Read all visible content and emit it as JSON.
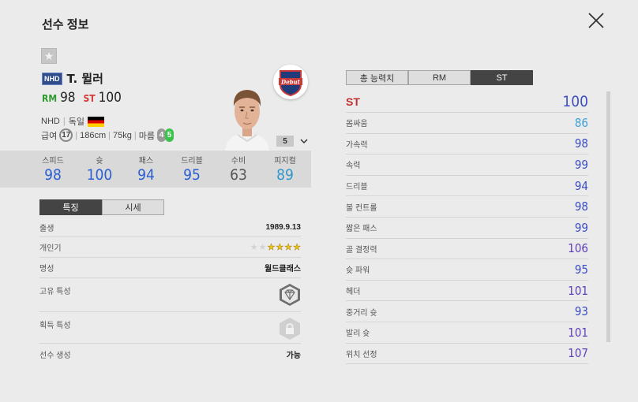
{
  "window": {
    "title": "선수 정보"
  },
  "player": {
    "season_tag": "NHD",
    "name": "T. 뮐러",
    "positions": [
      {
        "pos": "RM",
        "ovr": "98"
      },
      {
        "pos": "ST",
        "ovr": "100"
      }
    ],
    "club_season": "NHD",
    "nation": "독일",
    "salary_label": "급여",
    "salary": "17",
    "height": "186cm",
    "weight": "75kg",
    "body_type": "마름",
    "weak_foot_left": "4",
    "weak_foot_right": "5",
    "level": "5",
    "badge_text": "Debut"
  },
  "summary_stats": [
    {
      "label": "스피드",
      "value": "98",
      "color": "#2a5fd1"
    },
    {
      "label": "슛",
      "value": "100",
      "color": "#2a5fd1"
    },
    {
      "label": "패스",
      "value": "94",
      "color": "#2a5fd1"
    },
    {
      "label": "드리블",
      "value": "95",
      "color": "#2a5fd1"
    },
    {
      "label": "수비",
      "value": "63",
      "color": "#555555"
    },
    {
      "label": "피지컬",
      "value": "89",
      "color": "#3197c9"
    }
  ],
  "detail_tabs": {
    "active": "특징",
    "inactive": "시세"
  },
  "details": {
    "birth_label": "출생",
    "birth_value": "1989.9.13",
    "popularity_label": "개인기",
    "popularity_stars_filled": 4,
    "popularity_stars_total": 6,
    "reputation_label": "명성",
    "reputation_value": "월드클래스",
    "unique_trait_label": "고유 특성",
    "acquired_trait_label": "획득 특성",
    "create_label": "선수 생성",
    "create_value": "가능"
  },
  "rating_tabs": {
    "tab1": "총 능력치",
    "tab2": "RM",
    "tab3": "ST",
    "active": "ST"
  },
  "ratings": [
    {
      "label": "ST",
      "value": "100",
      "color": "#3b4ec4",
      "main": true
    },
    {
      "label": "몸싸움",
      "value": "86",
      "color": "#3d9ed6"
    },
    {
      "label": "가속력",
      "value": "98",
      "color": "#3b4ec4"
    },
    {
      "label": "속력",
      "value": "99",
      "color": "#3b4ec4"
    },
    {
      "label": "드리블",
      "value": "94",
      "color": "#3b4ec4"
    },
    {
      "label": "볼 컨트롤",
      "value": "98",
      "color": "#3b4ec4"
    },
    {
      "label": "짧은 패스",
      "value": "99",
      "color": "#3b4ec4"
    },
    {
      "label": "골 결정력",
      "value": "106",
      "color": "#5d3fb8"
    },
    {
      "label": "슛 파워",
      "value": "95",
      "color": "#3b4ec4"
    },
    {
      "label": "헤더",
      "value": "101",
      "color": "#5d3fb8"
    },
    {
      "label": "중거리 슛",
      "value": "93",
      "color": "#3b4ec4"
    },
    {
      "label": "발리 슛",
      "value": "101",
      "color": "#5d3fb8"
    },
    {
      "label": "위치 선정",
      "value": "107",
      "color": "#5d3fb8"
    }
  ]
}
